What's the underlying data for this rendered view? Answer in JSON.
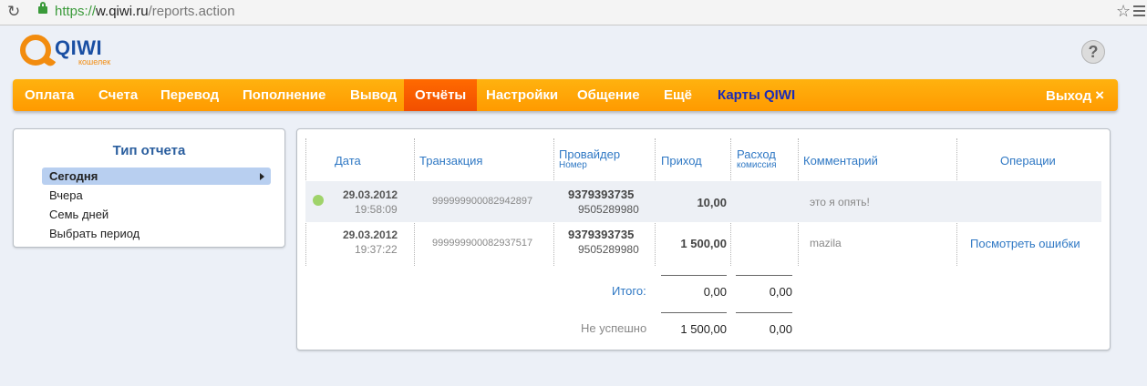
{
  "browser": {
    "url_scheme": "https://",
    "url_host": "w.qiwi.ru",
    "url_path": "/reports.action"
  },
  "logo": {
    "text": "QIWI",
    "sub": "кошелек"
  },
  "help": "?",
  "nav": {
    "items": [
      "Оплата",
      "Счета",
      "Перевод",
      "Пополнение",
      "Вывод",
      "Отчёты",
      "Настройки",
      "Общение",
      "Ещё",
      "Карты QIWI"
    ],
    "active": "Отчёты",
    "logout": "Выход",
    "logout_icon": "×",
    "colors": {
      "bar": "#ff9f00",
      "active": "#f25a00",
      "qiwi_link": "#1b2bb8"
    }
  },
  "report_type": {
    "title": "Тип отчета",
    "items": [
      "Сегодня",
      "Вчера",
      "Семь дней",
      "Выбрать период"
    ],
    "selected": "Сегодня"
  },
  "table": {
    "headers": {
      "date": "Дата",
      "transaction": "Транзакция",
      "provider": "Провайдер",
      "provider_sub": "Номер",
      "income": "Приход",
      "expense": "Расход",
      "expense_sub": "комиссия",
      "comment": "Комментарий",
      "operations": "Операции"
    },
    "rows": [
      {
        "status": "success",
        "date": "29.03.2012",
        "time": "19:58:09",
        "transaction": "999999900082942897",
        "provider": "9379393735",
        "number": "9505289980",
        "income": "10,00",
        "expense": "",
        "comment": "это я опять!",
        "operation": ""
      },
      {
        "status": "",
        "date": "29.03.2012",
        "time": "19:37:22",
        "transaction": "999999900082937517",
        "provider": "9379393735",
        "number": "9505289980",
        "income": "1 500,00",
        "expense": "",
        "comment": "mazila",
        "operation": "Посмотреть ошибки"
      }
    ],
    "totals": {
      "label": "Итого:",
      "income": "0,00",
      "expense": "0,00"
    },
    "failed": {
      "label": "Не успешно",
      "income": "1 500,00",
      "expense": "0,00"
    }
  }
}
